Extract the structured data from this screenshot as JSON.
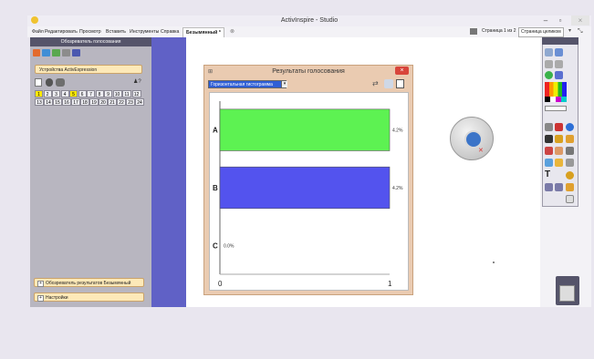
{
  "window": {
    "title": "ActivInspire - Studio",
    "min_label": "–",
    "max_label": "▫",
    "close_label": "×"
  },
  "menubar": {
    "items": [
      "Файл",
      "Редактировать",
      "Просмотр",
      "Вставить",
      "Инструменты",
      "Справка"
    ],
    "tab_label": "Безымянный *",
    "page_counter": "Страница 1 из 2",
    "view_mode": "Страница целиком"
  },
  "left_panel": {
    "header": "Обозреватель голосования",
    "devices_button": "Устройства ActivExpression",
    "numbers_row1": [
      "1",
      "2",
      "3",
      "4",
      "5",
      "6",
      "7",
      "8",
      "9",
      "10",
      "11",
      "12"
    ],
    "numbers_row2": [
      "13",
      "14",
      "15",
      "16",
      "17",
      "18",
      "19",
      "20",
      "21",
      "22",
      "23",
      "24"
    ],
    "highlighted": [
      "1",
      "5"
    ],
    "browser_button": "Обозреватель результатов Безымянный",
    "settings_button": "Настройки"
  },
  "dialog": {
    "title": "Результаты голосования",
    "chart_type_select": "Горизонтальная гистограмма",
    "close_label": "×"
  },
  "chart_data": {
    "type": "bar",
    "orientation": "horizontal",
    "categories": [
      "A",
      "B",
      "C"
    ],
    "values": [
      1,
      1,
      0
    ],
    "data_labels": [
      "4.2%",
      "4.2%",
      "0.0%"
    ],
    "xlim": [
      0,
      1
    ],
    "xticks": [
      "0",
      "1"
    ],
    "colors": [
      "#5df252",
      "#5353ee",
      "#c7c7c7"
    ],
    "grid": false
  }
}
